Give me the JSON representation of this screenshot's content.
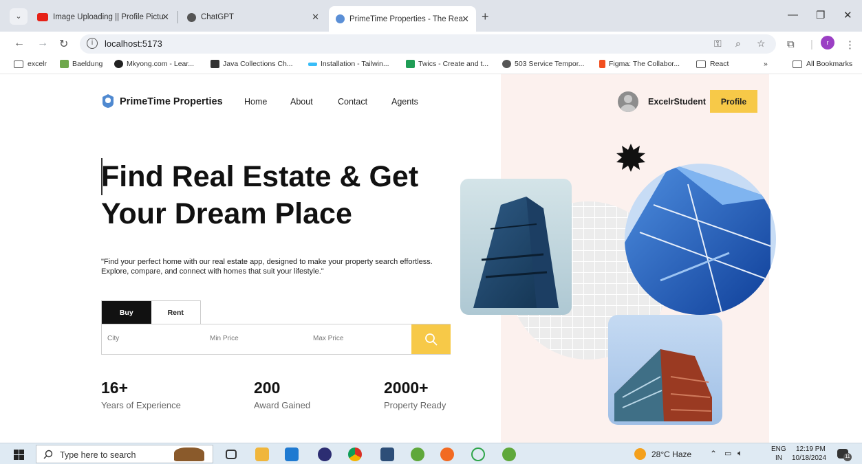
{
  "browser": {
    "tabs": [
      {
        "label": "Image Uploading || Profile Pictu",
        "close": "✕"
      },
      {
        "label": "ChatGPT",
        "close": "✕"
      },
      {
        "label": "PrimeTime Properties - The Rea",
        "close": "✕"
      }
    ],
    "new_tab": "+",
    "url": "localhost:5173",
    "bookmarks": [
      {
        "label": "excelr",
        "icon": "folder-icon"
      },
      {
        "label": "Baeldung",
        "icon": "baeldung-icon"
      },
      {
        "label": "Mkyong.com - Lear...",
        "icon": "mkyong-icon"
      },
      {
        "label": "Java Collections Ch...",
        "icon": "java-icon"
      },
      {
        "label": "Installation - Tailwin...",
        "icon": "tailwind-icon"
      },
      {
        "label": "Twics - Create and t...",
        "icon": "twics-icon"
      },
      {
        "label": "503 Service Tempor...",
        "icon": "globe-icon"
      },
      {
        "label": "Figma: The Collabor...",
        "icon": "figma-icon"
      },
      {
        "label": "React",
        "icon": "folder-icon"
      }
    ],
    "bookmarks_overflow": "»",
    "all_bookmarks": "All Bookmarks",
    "profile_initial": "r"
  },
  "site": {
    "brand": "PrimeTime Properties",
    "nav": [
      "Home",
      "About",
      "Contact",
      "Agents"
    ],
    "username": "ExcelrStudent",
    "profile_button": "Profile",
    "headline_line1": "Find Real Estate & Get",
    "headline_line2": "Your Dream Place",
    "tagline": "\"Find your perfect home with our real estate app, designed to make your property search effortless. Explore, compare, and connect with homes that suit your lifestyle.\"",
    "toggle": {
      "buy": "Buy",
      "rent": "Rent"
    },
    "search": {
      "city": "City",
      "min_price": "Min Price",
      "max_price": "Max Price"
    },
    "stats": [
      {
        "value": "16+",
        "label": "Years of Experience"
      },
      {
        "value": "200",
        "label": "Award Gained"
      },
      {
        "value": "2000+",
        "label": "Property Ready"
      }
    ],
    "colors": {
      "accent": "#f7c948",
      "hero_bg": "#fcf1ee",
      "dark": "#111111"
    }
  },
  "taskbar": {
    "search_placeholder": "Type here to search",
    "weather": "28°C  Haze",
    "lang_top": "ENG",
    "lang_bottom": "IN",
    "time": "12:19 PM",
    "date": "10/18/2024",
    "notifications": "11"
  }
}
